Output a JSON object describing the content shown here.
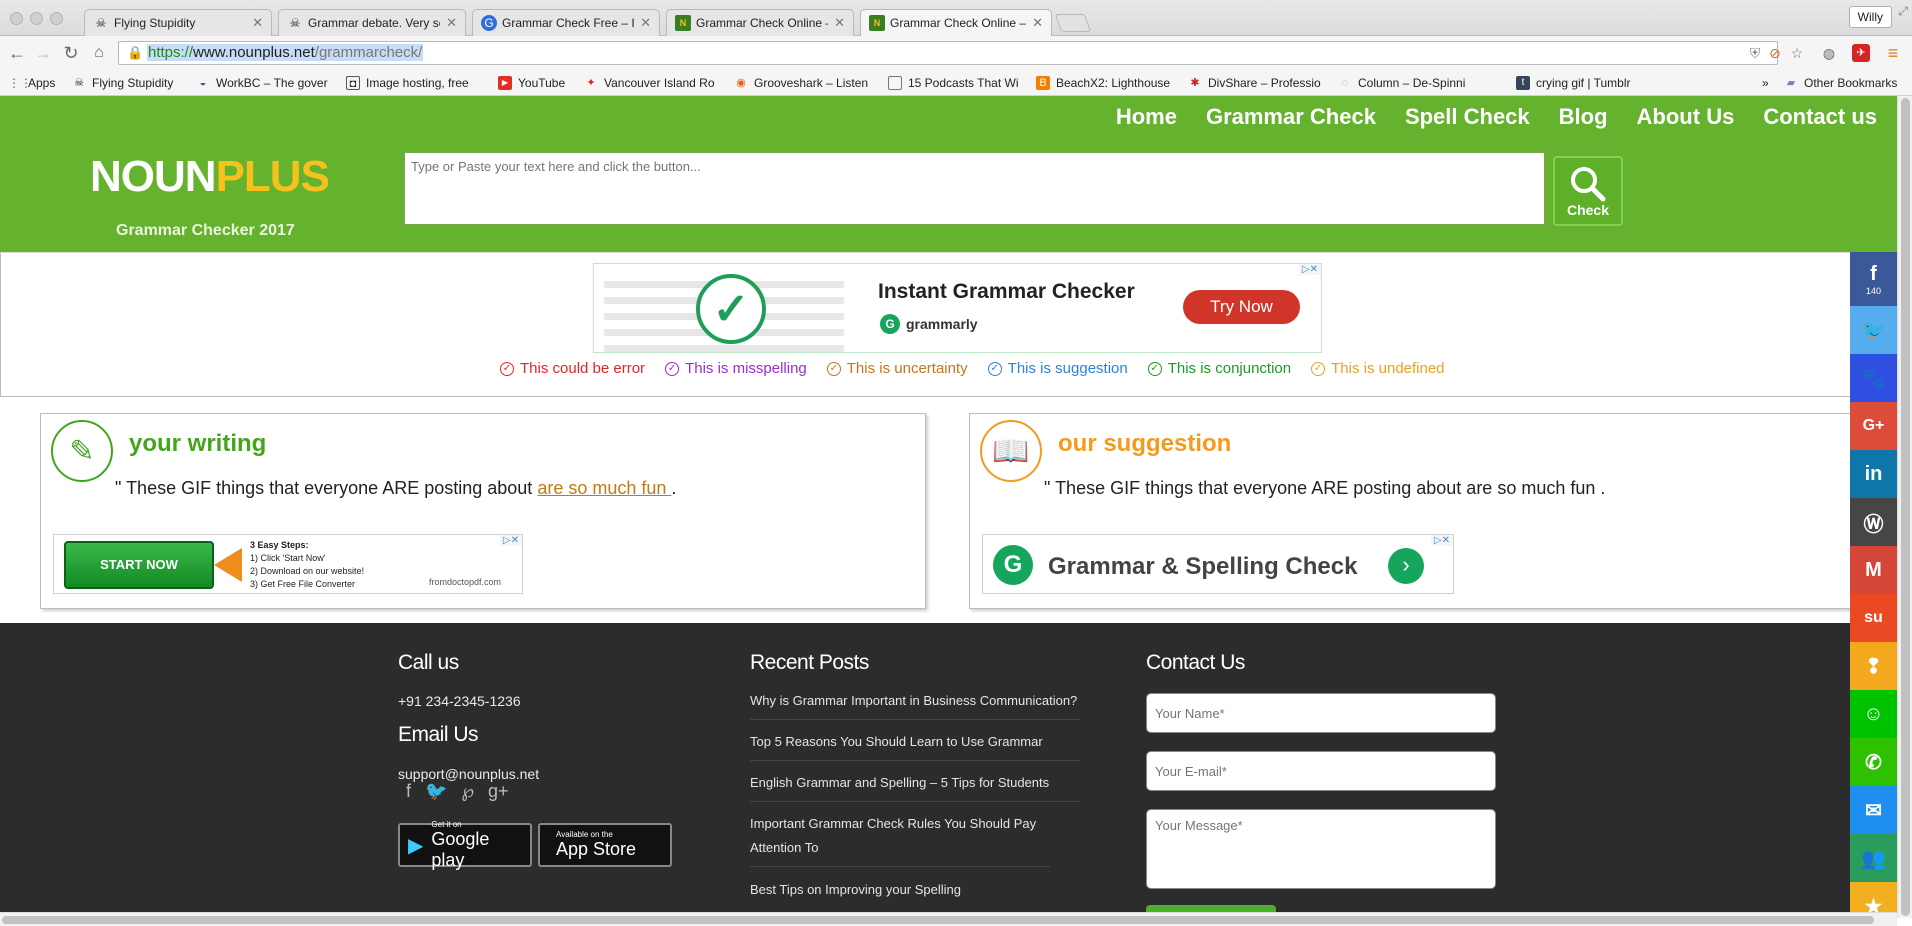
{
  "browser": {
    "tabs": [
      {
        "label": "Flying Stupidity",
        "icon": "skull-icon"
      },
      {
        "label": "Grammar debate. Very ser",
        "icon": "skull-icon"
      },
      {
        "label": "Grammar Check Free – It's",
        "icon": "blue-globe-icon"
      },
      {
        "label": "Grammar Check Online – Ir",
        "icon": "nounplus-icon"
      },
      {
        "label": "Grammar Check Online – Ir",
        "icon": "nounplus-icon"
      }
    ],
    "profile": "Willy",
    "url_scheme": "https://",
    "url_host": "www.nounplus.net",
    "url_path": "/grammarcheck/",
    "bookmarks": [
      {
        "label": "Apps"
      },
      {
        "label": "Flying Stupidity"
      },
      {
        "label": "WorkBC – The gover"
      },
      {
        "label": "Image hosting, free"
      },
      {
        "label": "YouTube"
      },
      {
        "label": "Vancouver Island Ro"
      },
      {
        "label": "Grooveshark – Listen"
      },
      {
        "label": "15 Podcasts That Wi"
      },
      {
        "label": "BeachX2: Lighthouse"
      },
      {
        "label": "DivShare – Professio"
      },
      {
        "label": "Column – De-Spinni"
      },
      {
        "label": "crying gif | Tumblr"
      }
    ],
    "bookmarks_more": "»",
    "other_bookmarks": "Other Bookmarks"
  },
  "header": {
    "nav": [
      "Home",
      "Grammar Check",
      "Spell Check",
      "Blog",
      "About Us",
      "Contact us"
    ],
    "logo_part1": "NOUN",
    "logo_part2": "PLUS",
    "tagline": "Grammar Checker 2017",
    "input_placeholder": "Type or Paste your text here and click the button...",
    "check_label": "Check"
  },
  "ad_top": {
    "title": "Instant Grammar Checker",
    "brand": "grammarly",
    "button": "Try Now"
  },
  "legend": [
    {
      "label": "This could be error",
      "color": "#e5252a"
    },
    {
      "label": "This is misspelling",
      "color": "#9b2ed1"
    },
    {
      "label": "This is uncertainty",
      "color": "#c5751b"
    },
    {
      "label": "This is suggestion",
      "color": "#2f7fe0"
    },
    {
      "label": "This is conjunction",
      "color": "#1c9a24"
    },
    {
      "label": "This is undefined",
      "color": "#e8a321"
    }
  ],
  "writing": {
    "title": "your writing",
    "text_before": "\" These GIF things that everyone ARE posting about ",
    "highlight": "are so much fun ",
    "text_after": ".",
    "color": "#43a51e"
  },
  "suggestion": {
    "title": "our suggestion",
    "text": "\" These GIF things that everyone ARE posting about are so much fun .",
    "color": "#f29b1e"
  },
  "ad_left": {
    "button": "START NOW",
    "steps_title": "3 Easy Steps:",
    "step1": "1) Click 'Start Now'",
    "step2": "2) Download on our website!",
    "step3": "3) Get Free File Converter",
    "site": "fromdoctopdf.com"
  },
  "ad_right": {
    "text": "Grammar & Spelling Check"
  },
  "footer": {
    "call_title": "Call us",
    "phone": "+91 234-2345-1236",
    "email_title": "Email Us",
    "email": "support@nounplus.net",
    "google_play_small": "Get it on",
    "google_play": "Google play",
    "app_store_small": "Available on the",
    "app_store": "App Store",
    "recent_title": "Recent Posts",
    "posts": [
      "Why is Grammar Important in Business Communication?",
      "Top 5 Reasons You Should Learn to Use Grammar",
      "English Grammar and Spelling – 5 Tips for Students",
      "Important Grammar Check Rules You Should Pay Attention To",
      "Best Tips on Improving your Spelling"
    ],
    "contact_title": "Contact Us",
    "name_placeholder": "Your Name*",
    "email_placeholder": "Your E-mail*",
    "message_placeholder": "Your Message*"
  },
  "share": {
    "facebook_count": "140",
    "buttons": [
      {
        "icon": "facebook-icon",
        "color": "#3b5998",
        "glyph": "f"
      },
      {
        "icon": "twitter-icon",
        "color": "#55acee",
        "glyph": "🐦"
      },
      {
        "icon": "baidu-icon",
        "color": "#2f4fe0",
        "glyph": "🐾"
      },
      {
        "icon": "google-plus-icon",
        "color": "#dd4b39",
        "glyph": "G+"
      },
      {
        "icon": "linkedin-icon",
        "color": "#0e76a8",
        "glyph": "in"
      },
      {
        "icon": "wordpress-icon",
        "color": "#464646",
        "glyph": "W"
      },
      {
        "icon": "gmail-icon",
        "color": "#d44638",
        "glyph": "M"
      },
      {
        "icon": "stumbleupon-icon",
        "color": "#eb4924",
        "glyph": "su"
      },
      {
        "icon": "kakao-icon",
        "color": "#f4a81d",
        "glyph": "!"
      },
      {
        "icon": "line-icon",
        "color": "#00c300",
        "glyph": "☺"
      },
      {
        "icon": "wechat-icon",
        "color": "#2dc100",
        "glyph": "✆"
      },
      {
        "icon": "messenger-icon",
        "color": "#1f8ef1",
        "glyph": "✉"
      },
      {
        "icon": "groups-icon",
        "color": "#2a9d5c",
        "glyph": "👥"
      },
      {
        "icon": "favorite-icon",
        "color": "#f2b01e",
        "glyph": "★"
      }
    ]
  }
}
